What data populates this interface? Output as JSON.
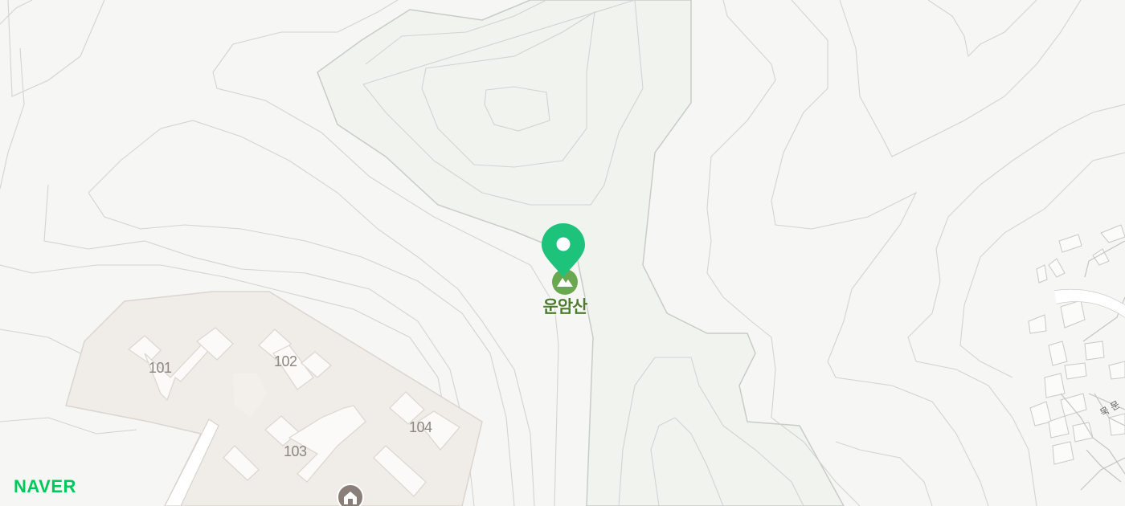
{
  "map": {
    "peak_name": "운암산",
    "buildings": [
      {
        "label": "101"
      },
      {
        "label": "102"
      },
      {
        "label": "103"
      },
      {
        "label": "104"
      }
    ],
    "street_label": "묵 문",
    "brand": "NAVER",
    "icons": {
      "pin": "location-pin-icon",
      "peak": "mountain-icon",
      "poi": "building-poi-icon"
    },
    "colors": {
      "pin": "#1ec37b",
      "peak": "#6aa84f",
      "peak_label": "#4d7c2f",
      "brand": "#03c75a"
    }
  }
}
